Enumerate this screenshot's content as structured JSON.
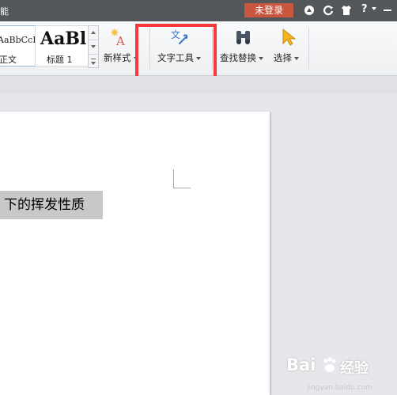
{
  "titlebar": {
    "partial_title": "能",
    "login_label": "未登录",
    "help_label": "?"
  },
  "ribbon": {
    "styles": [
      {
        "sample": "AaBbCcDd",
        "caption": "正文"
      },
      {
        "sample": "AaBl",
        "caption": "标题 1"
      }
    ],
    "new_style_label": "新样式",
    "text_tools_label": "文字工具",
    "find_replace_label": "查找替换",
    "select_label": "选择"
  },
  "document": {
    "selected_text": "下的挥发性质"
  },
  "watermark": {
    "brand": "Bai",
    "brand_suffix": "经验",
    "url": "jingyan.baidu.com"
  },
  "colors": {
    "titlebar_bg": "#545759",
    "login_btn_bg": "#c9563f",
    "highlight_border": "#f33b3b",
    "selection_bg": "#c8c8c8"
  },
  "icons": {
    "titlebar": [
      "skin-icon",
      "refresh-icon",
      "shirt-icon",
      "help-icon",
      "minimize-icon"
    ],
    "ribbon": [
      "new-style-icon",
      "text-tools-icon",
      "find-replace-icon",
      "select-cursor-icon"
    ]
  }
}
